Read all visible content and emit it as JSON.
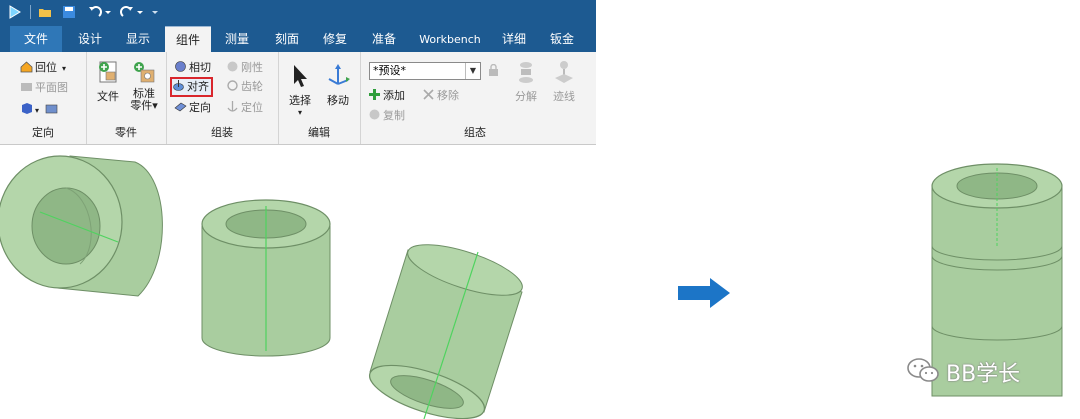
{
  "tabs": {
    "file": "文件",
    "design": "设计",
    "display": "显示",
    "assembly": "组件",
    "measure": "测量",
    "section": "刻面",
    "repair": "修复",
    "prepare": "准备",
    "workbench": "Workbench",
    "detail": "详细",
    "sheetmetal": "钣金"
  },
  "ribbon": {
    "orient": {
      "home": "回位",
      "plane_view": "平面图",
      "label": "定向"
    },
    "parts": {
      "file": "文件",
      "standard_line1": "标准",
      "standard_line2": "零件▾",
      "label": "零件"
    },
    "assemble": {
      "tangent": "相切",
      "rigid": "刚性",
      "align": "对齐",
      "gear": "齿轮",
      "orient": "定向",
      "anchor": "定位",
      "label": "组装"
    },
    "edit": {
      "select": "选择",
      "move": "移动",
      "label": "编辑"
    },
    "config": {
      "preset": "*预设*",
      "add": "添加",
      "remove": "移除",
      "copy": "复制",
      "explode": "分解",
      "trace": "迹线",
      "label": "组态"
    }
  },
  "watermark": "BB学长",
  "colors": {
    "ribbon_bar": "#1d5a91",
    "panel": "#f3f3f3",
    "highlight": "#d9262c",
    "part_fill": "#a9cd9f",
    "part_edge": "#6e8f66",
    "axis": "#4fd35f",
    "arrow": "#1c75c7"
  },
  "icons": {
    "app": "app-logo-icon",
    "open": "folder-open-icon",
    "save": "save-icon",
    "undo": "undo-icon",
    "redo": "redo-icon",
    "arrow": "right-arrow-icon",
    "wechat": "wechat-icon"
  }
}
